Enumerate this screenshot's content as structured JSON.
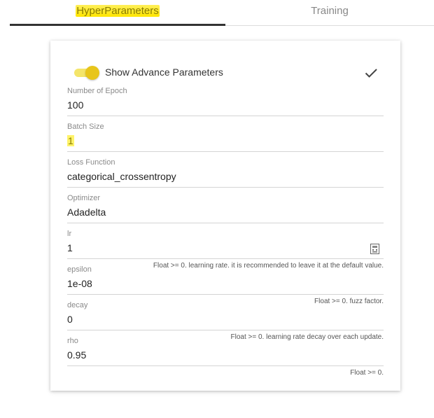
{
  "tabs": [
    {
      "label": "HyperParameters",
      "active": true
    },
    {
      "label": "Training",
      "active": false
    }
  ],
  "advanced": {
    "toggle_on": true,
    "label": "Show Advance Parameters",
    "confirm_icon": "check-icon"
  },
  "fields": {
    "epoch": {
      "label": "Number of Epoch",
      "value": "100"
    },
    "batch": {
      "label": "Batch Size",
      "value": "1"
    },
    "loss": {
      "label": "Loss Function",
      "value": "categorical_crossentropy"
    },
    "optimizer": {
      "label": "Optimizer",
      "value": "Adadelta"
    },
    "lr": {
      "label": "lr",
      "value": "1",
      "hint": "Float >= 0. learning rate. it is recommended to leave it at the default value.",
      "icon": "calculator-icon"
    },
    "epsilon": {
      "label": "epsilon",
      "value": "1e-08",
      "hint": "Float >= 0. fuzz factor."
    },
    "decay": {
      "label": "decay",
      "value": "0",
      "hint": "Float >= 0. learning rate decay over each update."
    },
    "rho": {
      "label": "rho",
      "value": "0.95",
      "hint": "Float >= 0."
    }
  },
  "colors": {
    "accent": "#e8c51a",
    "highlight": "#fff36a",
    "tab_ink": "#333333"
  }
}
